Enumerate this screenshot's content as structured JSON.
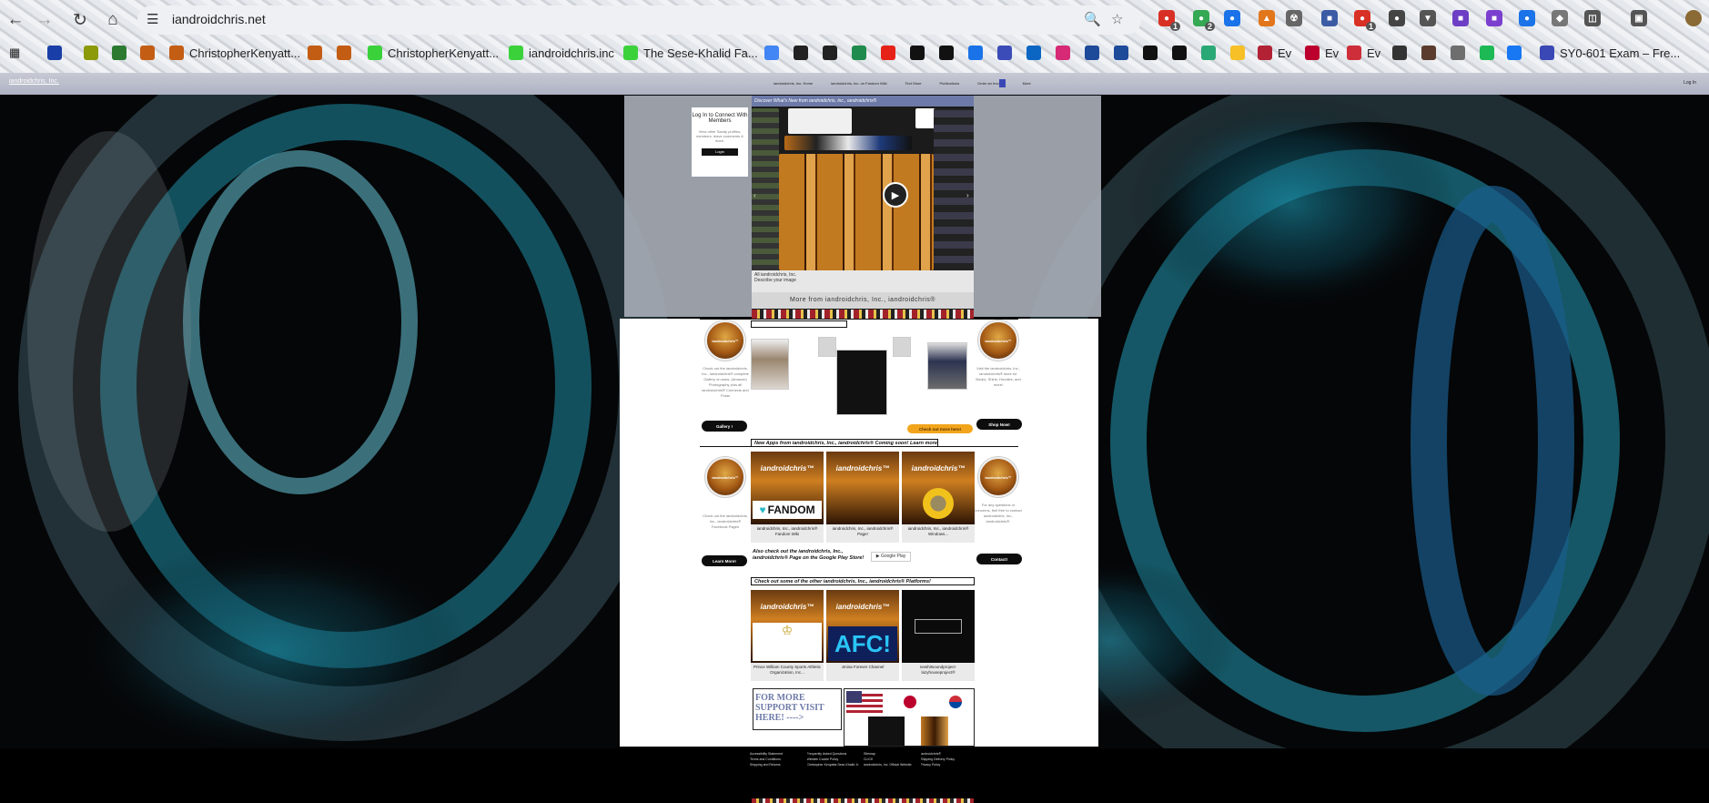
{
  "browser": {
    "url": "iandroidchris.net",
    "bookmarks": [
      {
        "label": "",
        "color": "#1a3ea8"
      },
      {
        "label": "",
        "color": "#8c9a0a"
      },
      {
        "label": "",
        "color": "#2b7a30"
      },
      {
        "label": "",
        "color": "#c45d14"
      },
      {
        "label": "ChristopherKenyatt...",
        "color": "#c45d14"
      },
      {
        "label": "",
        "color": "#c45d14"
      },
      {
        "label": "",
        "color": "#c45d14"
      },
      {
        "label": "ChristopherKenyatt...",
        "color": "#3bd13b"
      },
      {
        "label": "iandroidchris.inc",
        "color": "#3bd13b"
      },
      {
        "label": "The Sese-Khalid Fa...",
        "color": "#3bd13b"
      },
      {
        "label": "",
        "color": "#4285f4"
      },
      {
        "label": "",
        "color": "#222222"
      },
      {
        "label": "",
        "color": "#222222"
      },
      {
        "label": "",
        "color": "#1f8b4c"
      },
      {
        "label": "",
        "color": "#e62117"
      },
      {
        "label": "",
        "color": "#111111"
      },
      {
        "label": "",
        "color": "#111111"
      },
      {
        "label": "",
        "color": "#1a73e8"
      },
      {
        "label": "",
        "color": "#3b4cb8"
      },
      {
        "label": "",
        "color": "#0a66c2"
      },
      {
        "label": "",
        "color": "#d62976"
      },
      {
        "label": "",
        "color": "#1e4a9a"
      },
      {
        "label": "",
        "color": "#1e4a9a"
      },
      {
        "label": "",
        "color": "#111111"
      },
      {
        "label": "",
        "color": "#111111"
      },
      {
        "label": "",
        "color": "#2aa876"
      },
      {
        "label": "",
        "color": "#f6c026"
      },
      {
        "label": "Ev",
        "color": "#b22234"
      },
      {
        "label": "Ev",
        "color": "#bc002d"
      },
      {
        "label": "Ev",
        "color": "#cd2e3a"
      },
      {
        "label": "",
        "color": "#333333"
      },
      {
        "label": "",
        "color": "#5a3b2e"
      },
      {
        "label": "",
        "color": "#6e6e6e"
      },
      {
        "label": "",
        "color": "#1db954"
      },
      {
        "label": "",
        "color": "#1877f2"
      },
      {
        "label": "SY0-601 Exam – Fre...",
        "color": "#3a48b5"
      }
    ]
  },
  "site": {
    "brand": "iandroidchris, Inc.",
    "menu": [
      "iandroidchris, Inc. Home",
      "iandroidchris, Inc. on Fandom Wiki",
      "Text Store",
      "Publications",
      "Order an Invoice",
      "More"
    ],
    "login": "Log In",
    "login_box": {
      "title": "Log In to Connect With Members",
      "body": "View other Sandy profiles, members, leave comments & more.",
      "button": "Login"
    },
    "gallery": {
      "header": "Discover What's New from iandroidchris, Inc., iandroidchris®",
      "caption_title": "All iandroidchris, Inc.",
      "caption_desc": "Describe your image",
      "more": "More from iandroidchris, Inc., iandroidchris®"
    },
    "row1": {
      "left_text": "Check out the iandroidchris, Inc., iandroidchris® complete Gallery on www. (Amazon) Photography plus all iandroidchris® Connects and Posts",
      "left_button": "Gallery !",
      "right_text": "Visit the iandroidchris, Inc., iandroidchris® store for Books, Shirts, Hoodies, and more!",
      "right_button": "Shop Now!",
      "center_button": "Check out more here!"
    },
    "apps": {
      "title": "New Apps from iandroidchris, Inc., iandroidchris® Coming soon! Learn more!",
      "brand": "iandroidchris™",
      "cards": [
        {
          "label": "iandroidchris, Inc., iandroidchris® Fandom Wiki"
        },
        {
          "label": "iandroidchris, Inc., iandroidchris® Page!"
        },
        {
          "label": "iandroidchris, Inc., iandroidchris® Windows..."
        }
      ],
      "left_text": "Check out the iandroidchris, Inc., iandroidchris® Facebook Pages",
      "left_button": "Learn More!",
      "right_text": "For any questions or concerns, feel free to contact iandroidchris, Inc., iandroidchris®.",
      "right_button": "Contact!",
      "fandom_word": "FANDOM",
      "play_text": "Also check out the iandroidchris, Inc., iandroidchris® Page on the Google Play Store!",
      "play_badge": "Google Play"
    },
    "platforms": {
      "title": "Check out some of the other iandroidchris, Inc., iandroidchris® Platforms!",
      "cards": [
        {
          "label": "Prince William County Sports Athletic Organization, Inc..."
        },
        {
          "label": "Jmina Forever Channel"
        },
        {
          "label": "newhitsoundproject-lazyhouseproject®"
        }
      ]
    },
    "support": "FOR MORE SUPPORT VISIT HERE! ---->",
    "footer_links": [
      "Accessibility Statement",
      "Frequently Asked Questions",
      "Sitemap",
      "iandroidchris®",
      "Terms and Conditions",
      "Website Cookie Policy",
      "CLICK",
      "Shipping Delivery Policy",
      "Shipping and Returns",
      "Christopher Kenyatta Sese-Khalid Jr. Official Website",
      "iandroidchris, Inc. Official Website",
      "Privacy Policy"
    ]
  }
}
